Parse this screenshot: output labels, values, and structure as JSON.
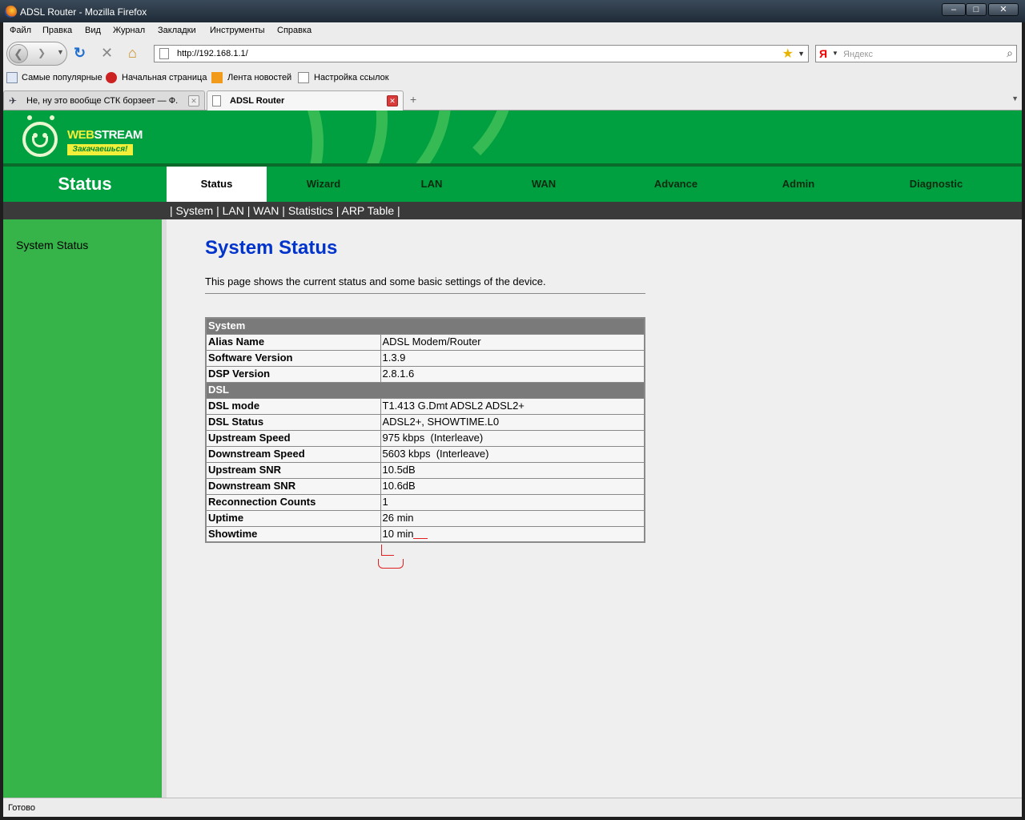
{
  "window": {
    "title": "ADSL Router - Mozilla Firefox",
    "min": "–",
    "max": "□",
    "close": "✕"
  },
  "menu": [
    "Файл",
    "Правка",
    "Вид",
    "Журнал",
    "Закладки",
    "Инструменты",
    "Справка"
  ],
  "navigation": {
    "url": "http://192.168.1.1/",
    "search_placeholder": "Яндекс",
    "search_engine": "Я"
  },
  "bookmarks": [
    "Самые популярные",
    "Начальная страница",
    "Лента новостей",
    "Настройка ссылок"
  ],
  "tabs": [
    {
      "label": "Не, ну это вообще СТК борзеет — Ф..."
    },
    {
      "label": "ADSL Router"
    }
  ],
  "router": {
    "logo": {
      "web": "WEB",
      "stream": "STREAM",
      "slogan": "Закачаешься!"
    },
    "section_title": "Status",
    "nav": [
      "Status",
      "Wizard",
      "LAN",
      "WAN",
      "Advance",
      "Admin",
      "Diagnostic"
    ],
    "subnav": "| System | LAN | WAN | Statistics | ARP Table |",
    "sidebar": [
      "System Status"
    ],
    "page_title": "System Status",
    "description": "This page shows the current status and some basic settings of the device.",
    "table": [
      {
        "header": "System"
      },
      {
        "k": "Alias Name",
        "v": "ADSL Modem/Router"
      },
      {
        "k": "Software Version",
        "v": "1.3.9"
      },
      {
        "k": "DSP Version",
        "v": "2.8.1.6"
      },
      {
        "header": "DSL"
      },
      {
        "k": "DSL mode",
        "v": "T1.413 G.Dmt ADSL2 ADSL2+"
      },
      {
        "k": "DSL Status",
        "v": "ADSL2+, SHOWTIME.L0"
      },
      {
        "k": "Upstream Speed",
        "v": "975 kbps  (Interleave)"
      },
      {
        "k": "Downstream Speed",
        "v": "5603 kbps  (Interleave)"
      },
      {
        "k": "Upstream SNR",
        "v": "10.5dB"
      },
      {
        "k": "Downstream SNR",
        "v": "10.6dB"
      },
      {
        "k": "Reconnection Counts",
        "v": "1"
      },
      {
        "k": "Uptime",
        "v": "26 min"
      },
      {
        "k": "Showtime",
        "v": "10 min"
      }
    ]
  },
  "statusbar": "Готово",
  "colors": {
    "brand_green": "#00a040",
    "sidebar_green": "#36b44a",
    "title_blue": "#0033cc"
  }
}
